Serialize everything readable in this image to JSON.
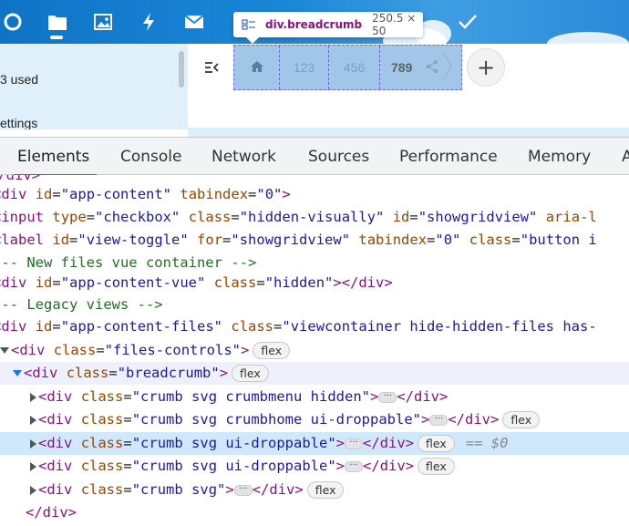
{
  "sidebar": {
    "quota_text": "3 used",
    "settings_text": "ettings"
  },
  "breadcrumb": {
    "crumbs": [
      "123",
      "456",
      "789"
    ]
  },
  "add_button": {
    "label": "+"
  },
  "tooltip": {
    "element": "div.breadcrumb",
    "size": "250.5 × 50"
  },
  "devtools": {
    "tabs": [
      "Elements",
      "Console",
      "Network",
      "Sources",
      "Performance",
      "Memory",
      "A"
    ],
    "active_tab": "Elements"
  },
  "code": {
    "l0": "</div>",
    "l1": {
      "tag": "div",
      "attrs": [
        [
          "id",
          "\"app-content\""
        ],
        [
          "tabindex",
          "\"0\""
        ]
      ]
    },
    "l2": {
      "tag": "input",
      "attrs": [
        [
          "type",
          "\"checkbox\""
        ],
        [
          "class",
          "\"hidden-visually\""
        ],
        [
          "id",
          "\"showgridview\""
        ],
        [
          "aria-l",
          ""
        ]
      ]
    },
    "l3": {
      "tag": "label",
      "attrs": [
        [
          "id",
          "\"view-toggle\""
        ],
        [
          "for",
          "\"showgridview\""
        ],
        [
          "tabindex",
          "\"0\""
        ],
        [
          "class",
          "\"button i"
        ]
      ]
    },
    "l4": "!-- New files vue container -->",
    "l5": {
      "tag": "div",
      "attrs": [
        [
          "id",
          "\"app-content-vue\""
        ],
        [
          "class",
          "\"hidden\""
        ]
      ],
      "close": "></div>"
    },
    "l6": "!-- Legacy views -->",
    "l7": {
      "tag": "div",
      "attrs": [
        [
          "id",
          "\"app-content-files\""
        ],
        [
          "class",
          "\"viewcontainer hide-hidden-files has-"
        ]
      ]
    },
    "l8": {
      "tag": "div",
      "attrs": [
        [
          "class",
          "\"files-controls\""
        ]
      ]
    },
    "l9": {
      "tag": "div",
      "attrs": [
        [
          "class",
          "\"breadcrumb\""
        ]
      ]
    },
    "l10": {
      "tag": "div",
      "attrs": [
        [
          "class",
          "\"crumb svg crumbmenu hidden\""
        ]
      ]
    },
    "l11": {
      "tag": "div",
      "attrs": [
        [
          "class",
          "\"crumb svg crumbhome ui-droppable\""
        ]
      ]
    },
    "l12": {
      "tag": "div",
      "attrs": [
        [
          "class",
          "\"crumb svg ui-droppable\""
        ]
      ]
    },
    "l13": {
      "tag": "div",
      "attrs": [
        [
          "class",
          "\"crumb svg ui-droppable\""
        ]
      ]
    },
    "l14": {
      "tag": "div",
      "attrs": [
        [
          "class",
          "\"crumb svg\""
        ]
      ]
    },
    "l15": "</div>",
    "flex_label": "flex",
    "dots_label": "···",
    "selected_marker": "== $0"
  },
  "colors": {
    "appbar_blue": "#1a86d8",
    "tag": "#881280",
    "attr": "#994500",
    "value": "#1a1aa6",
    "comment": "#236e25",
    "selected_row": "#cfe8fc",
    "active_tab_underline": "#1a73e8"
  },
  "icons": [
    "circle-logo-icon",
    "folder-icon",
    "photos-icon",
    "activity-icon",
    "mail-icon",
    "check-icon",
    "menu-toggle-icon",
    "home-icon",
    "share-icon",
    "breadcrumb-element-icon"
  ]
}
